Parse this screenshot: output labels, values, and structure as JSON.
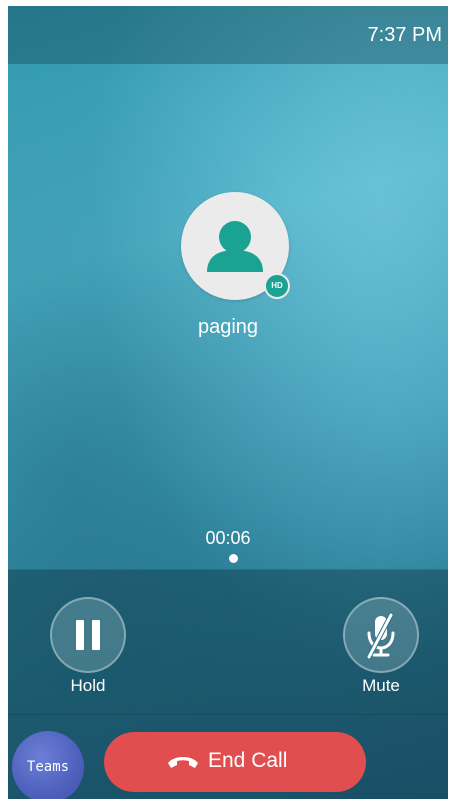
{
  "status_bar": {
    "time": "7:37 PM"
  },
  "call": {
    "contact_name": "paging",
    "hd_badge": "HD",
    "duration": "00:06"
  },
  "controls": {
    "hold_label": "Hold",
    "mute_label": "Mute"
  },
  "bottom_bar": {
    "teams_label": "Teams",
    "end_call_label": "End Call"
  },
  "icons": {
    "avatar": "person-icon",
    "hold": "pause-icon",
    "mute": "microphone-muted-icon",
    "end_call": "phone-hangup-icon"
  },
  "colors": {
    "avatar_accent": "#1aa392",
    "end_call": "#e04e4f",
    "teams": "#4a5bb8"
  }
}
